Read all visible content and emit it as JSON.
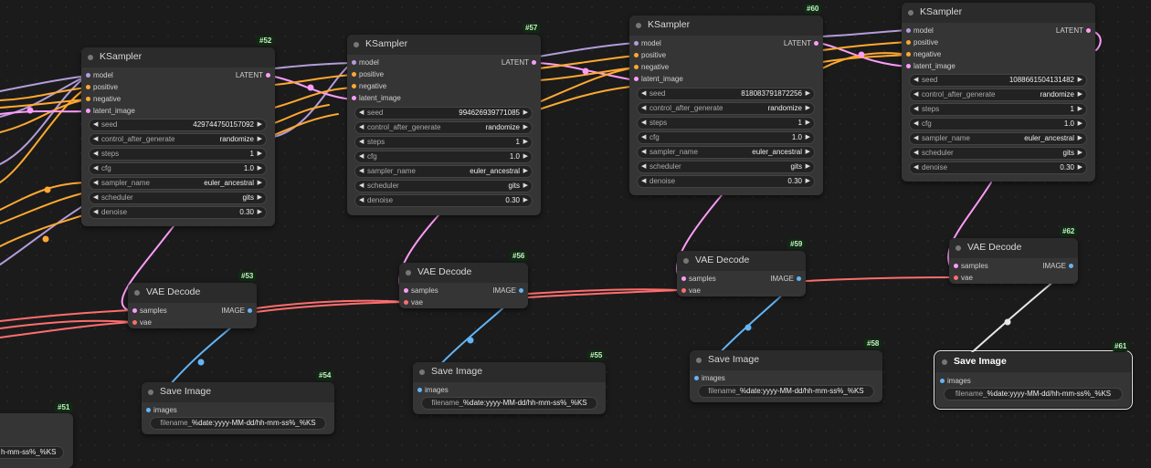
{
  "colors": {
    "model": "#b39ddb",
    "conditioning": "#ffa931",
    "latent": "#ff9cf9",
    "vae": "#ff6e6e",
    "image": "#64b5f6",
    "badge_bg": "#102a12"
  },
  "slot_labels": {
    "model": "model",
    "positive": "positive",
    "negative": "negative",
    "latent_image": "latent_image",
    "latent_out": "LATENT",
    "samples": "samples",
    "vae": "vae",
    "image_out": "IMAGE",
    "images": "images"
  },
  "widget_labels": {
    "seed": "seed",
    "control_after_generate": "control_after_generate",
    "steps": "steps",
    "cfg": "cfg",
    "sampler_name": "sampler_name",
    "scheduler": "scheduler",
    "denoise": "denoise",
    "filename": "filename_"
  },
  "ksamplers": [
    {
      "id": "#52",
      "title": "KSampler",
      "seed": "429744750157092",
      "control_after_generate": "randomize",
      "steps": "1",
      "cfg": "1.0",
      "sampler_name": "euler_ancestral",
      "scheduler": "gits",
      "denoise": "0.30"
    },
    {
      "id": "#57",
      "title": "KSampler",
      "seed": "994626939771085",
      "control_after_generate": "randomize",
      "steps": "1",
      "cfg": "1.0",
      "sampler_name": "euler_ancestral",
      "scheduler": "gits",
      "denoise": "0.30"
    },
    {
      "id": "#60",
      "title": "KSampler",
      "seed": "818083791872256",
      "control_after_generate": "randomize",
      "steps": "1",
      "cfg": "1.0",
      "sampler_name": "euler_ancestral",
      "scheduler": "gits",
      "denoise": "0.30"
    },
    {
      "id": "",
      "title": "KSampler",
      "seed": "1088661504131482",
      "control_after_generate": "randomize",
      "steps": "1",
      "cfg": "1.0",
      "sampler_name": "euler_ancestral",
      "scheduler": "gits",
      "denoise": "0.30"
    }
  ],
  "vae_decodes": [
    {
      "id": "#53",
      "title": "VAE Decode"
    },
    {
      "id": "#56",
      "title": "VAE Decode"
    },
    {
      "id": "#59",
      "title": "VAE Decode"
    },
    {
      "id": "#62",
      "title": "VAE Decode"
    }
  ],
  "save_images": [
    {
      "id": "#54",
      "title": "Save Image",
      "filename_value": "%date:yyyy-MM-dd/hh-mm-ss%_%KS"
    },
    {
      "id": "#55",
      "title": "Save Image",
      "filename_value": "%date:yyyy-MM-dd/hh-mm-ss%_%KS"
    },
    {
      "id": "#58",
      "title": "Save Image",
      "filename_value": "%date:yyyy-MM-dd/hh-mm-ss%_%KS"
    },
    {
      "id": "#61",
      "title": "Save Image",
      "filename_value": "%date:yyyy-MM-dd/hh-mm-ss%_%KS"
    }
  ],
  "partial_node": {
    "id": "#51",
    "visible_text": "h-mm-ss%_%KS"
  }
}
